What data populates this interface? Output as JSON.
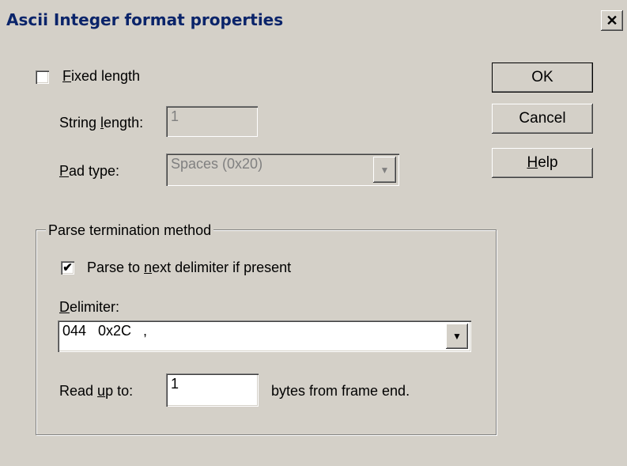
{
  "window": {
    "title": "Ascii Integer format properties",
    "close_glyph": "✕"
  },
  "fixed_length": {
    "label_prefix": "",
    "label_mnemonic": "F",
    "label_rest": "ixed length",
    "checked": false
  },
  "string_length": {
    "label_before": "String ",
    "label_mnemonic": "l",
    "label_after": "ength:",
    "value": "1"
  },
  "pad_type": {
    "label_mnemonic": "P",
    "label_rest": "ad type:",
    "value": "Spaces (0x20)"
  },
  "buttons": {
    "ok": "OK",
    "cancel": "Cancel",
    "help_mnemonic": "H",
    "help_rest": "elp"
  },
  "parse_group": {
    "title": "Parse termination method",
    "next_delim": {
      "label_before": "Parse to ",
      "label_mnemonic": "n",
      "label_after": "ext delimiter if present",
      "checked": true,
      "check_glyph": "✔"
    },
    "delimiter": {
      "label_mnemonic": "D",
      "label_rest": "elimiter:",
      "value": "044   0x2C   ,"
    },
    "read_up_to": {
      "label_before": "Read ",
      "label_mnemonic": "u",
      "label_after": "p to:",
      "value": "1",
      "suffix": "bytes from frame end."
    }
  },
  "icons": {
    "dropdown": "▼"
  }
}
